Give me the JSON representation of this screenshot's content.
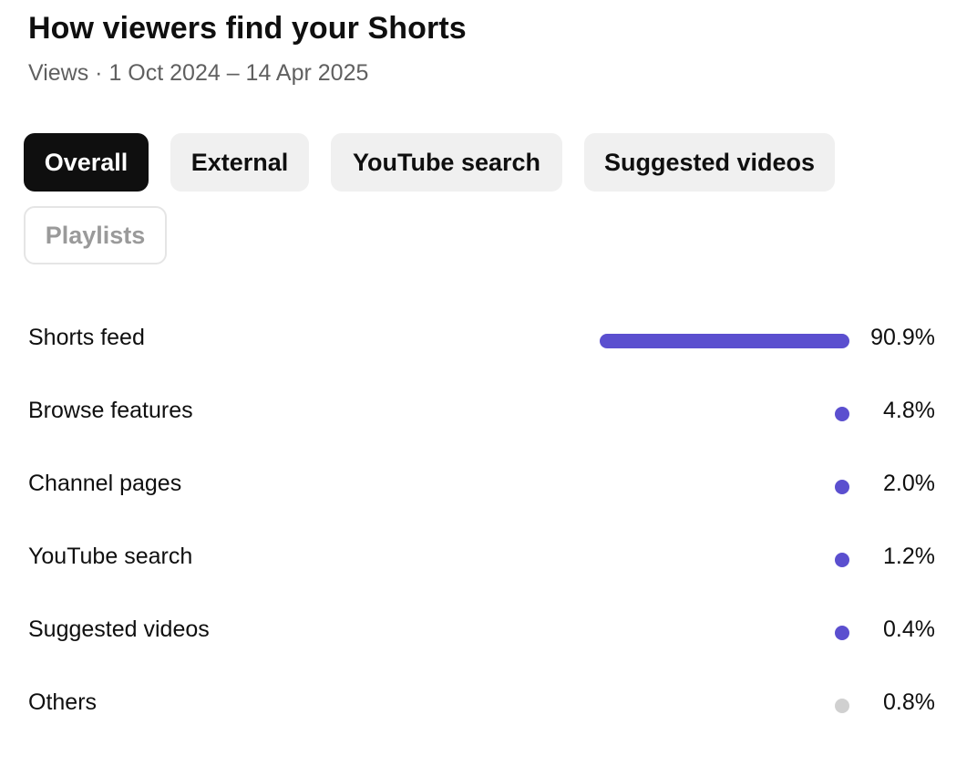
{
  "header": {
    "title": "How viewers find your Shorts",
    "subtitle": "Views · 1 Oct 2024 – 14 Apr 2025"
  },
  "chips": [
    {
      "label": "Overall",
      "state": "active"
    },
    {
      "label": "External",
      "state": "normal"
    },
    {
      "label": "YouTube search",
      "state": "normal"
    },
    {
      "label": "Suggested videos",
      "state": "normal"
    },
    {
      "label": "Playlists",
      "state": "disabled"
    }
  ],
  "colors": {
    "bar": "#5b4fcf",
    "others": "#d0d0d0"
  },
  "sources": [
    {
      "label": "Shorts feed",
      "value_text": "90.9%",
      "percent": 90.9,
      "color": "#5b4fcf"
    },
    {
      "label": "Browse features",
      "value_text": "4.8%",
      "percent": 4.8,
      "color": "#5b4fcf"
    },
    {
      "label": "Channel pages",
      "value_text": "2.0%",
      "percent": 2.0,
      "color": "#5b4fcf"
    },
    {
      "label": "YouTube search",
      "value_text": "1.2%",
      "percent": 1.2,
      "color": "#5b4fcf"
    },
    {
      "label": "Suggested videos",
      "value_text": "0.4%",
      "percent": 0.4,
      "color": "#5b4fcf"
    },
    {
      "label": "Others",
      "value_text": "0.8%",
      "percent": 0.8,
      "color": "#d0d0d0"
    }
  ]
}
